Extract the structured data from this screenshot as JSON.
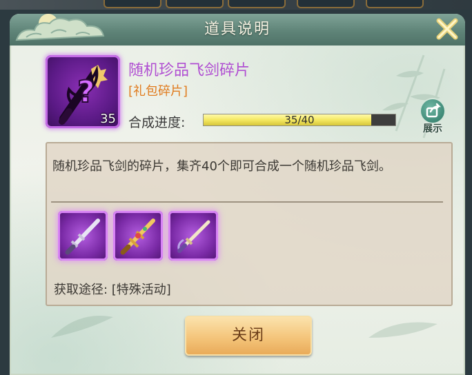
{
  "dialog": {
    "title": "道具说明",
    "close_icon": "close-x-icon"
  },
  "item": {
    "name": "随机珍品飞剑碎片",
    "tag": "[礼包碎片]",
    "count": "35",
    "icon": "mystery-sword-fragment-icon",
    "name_color": "#b04fd2",
    "tag_color": "#e07a1c"
  },
  "progress": {
    "label": "合成进度:",
    "text": "35/40",
    "current": 35,
    "total": 40
  },
  "share": {
    "label": "展示",
    "icon": "share-icon"
  },
  "description": {
    "text": "随机珍品飞剑的碎片，集齐40个即可合成一个随机珍品飞剑。"
  },
  "rewards": [
    {
      "name": "sword-preview-1",
      "icon": "sword-icon"
    },
    {
      "name": "sword-preview-2",
      "icon": "sword-icon"
    },
    {
      "name": "sword-preview-3",
      "icon": "sword-icon"
    }
  ],
  "source": {
    "text": "获取途径: [特殊活动]"
  },
  "buttons": {
    "close_label": "关闭"
  }
}
